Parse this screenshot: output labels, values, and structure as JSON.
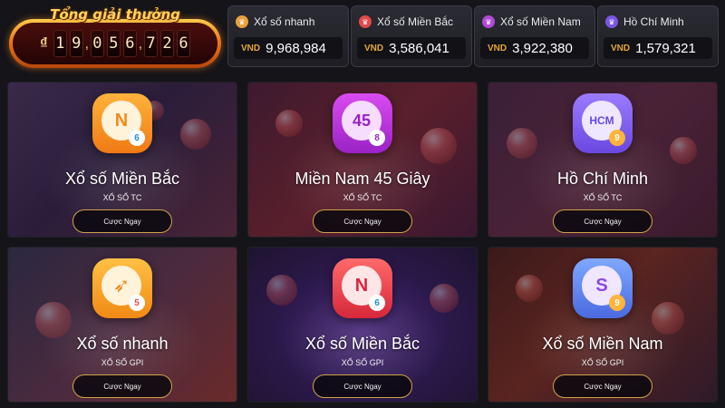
{
  "jackpot": {
    "title": "Tổng giải thưởng",
    "currency_symbol": "₫",
    "digits": [
      "1",
      "9",
      "0",
      "5",
      "6",
      "7",
      "2",
      "6"
    ]
  },
  "prizes": [
    {
      "name": "Xổ số nhanh",
      "currency": "VND",
      "amount": "9,968,984",
      "icon": "lottery-orange-icon",
      "icon_color": "#e9a23b"
    },
    {
      "name": "Xổ số Miền Bắc",
      "currency": "VND",
      "amount": "3,586,041",
      "icon": "lottery-red-icon",
      "icon_color": "#e24a4a"
    },
    {
      "name": "Xổ số Miền Nam",
      "currency": "VND",
      "amount": "3,922,380",
      "icon": "lottery-purple-icon",
      "icon_color": "#b04ad6"
    },
    {
      "name": "Hồ Chí Minh",
      "currency": "VND",
      "amount": "1,579,321",
      "icon": "lottery-violet-icon",
      "icon_color": "#7a55e6"
    }
  ],
  "cards": [
    {
      "title": "Xổ số Miền Bắc",
      "subtitle": "XỔ SỐ TC",
      "button": "Cược Ngay",
      "icon_letter": "N",
      "icon_mini": "6",
      "icon_name": "mien-bac-tc-icon"
    },
    {
      "title": "Miền Nam 45 Giây",
      "subtitle": "XỔ SỐ TC",
      "button": "Cược Ngay",
      "icon_letter": "45",
      "icon_mini": "8",
      "icon_name": "mien-nam-45-icon"
    },
    {
      "title": "Hồ Chí Minh",
      "subtitle": "XỔ SỐ TC",
      "button": "Cược Ngay",
      "icon_letter": "HCM",
      "icon_mini": "9",
      "icon_name": "ho-chi-minh-icon"
    },
    {
      "title": "Xổ số nhanh",
      "subtitle": "XỔ SỐ GPI",
      "button": "Cược Ngay",
      "icon_letter": "",
      "icon_mini": "5",
      "icon_name": "xo-so-nhanh-icon"
    },
    {
      "title": "Xổ số Miền Bắc",
      "subtitle": "XỔ SỐ GPI",
      "button": "Cược Ngay",
      "icon_letter": "N",
      "icon_mini": "6",
      "icon_name": "mien-bac-gpi-icon"
    },
    {
      "title": "Xổ số Miền Nam",
      "subtitle": "XỔ SỐ GPI",
      "button": "Cược Ngay",
      "icon_letter": "S",
      "icon_mini": "9",
      "icon_name": "mien-nam-gpi-icon"
    }
  ],
  "colors": {
    "background": "#141419",
    "button_border": "#cfa24a",
    "currency_gold": "#e3a935"
  }
}
